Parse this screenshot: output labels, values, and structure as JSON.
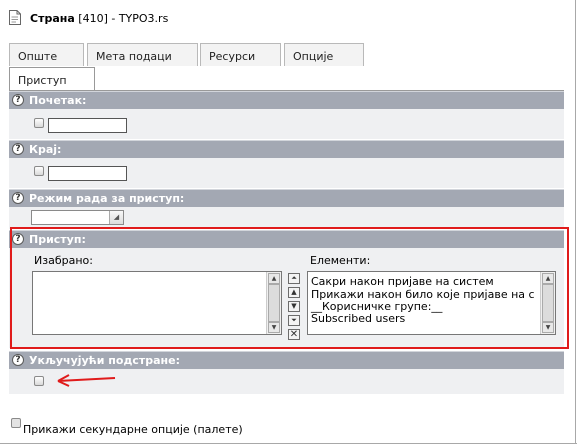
{
  "header": {
    "title_bold": "Страна",
    "title_rest": " [410] - TYPO3.rs"
  },
  "tabs": [
    {
      "label": "Опште",
      "active": false
    },
    {
      "label": "Мета подаци",
      "active": false
    },
    {
      "label": "Ресурси",
      "active": false
    },
    {
      "label": "Опције",
      "active": false
    },
    {
      "label": "Приступ",
      "active": true
    }
  ],
  "sections": {
    "start": {
      "label": "Почетак:",
      "value": ""
    },
    "end": {
      "label": "Крај:",
      "value": ""
    },
    "access_mode": {
      "label": "Режим рада за приступ:",
      "selected": ""
    },
    "access": {
      "label": "Приступ:",
      "selected_label": "Изабрано:",
      "items_label": "Елементи:",
      "selected_items": [],
      "available_items": [
        "Сакри након пријаве на систем",
        "Прикажи након било које пријаве на с",
        "__Корисничке групе:__",
        "Subscribed users"
      ]
    },
    "include_subpages": {
      "label": "Укључујући подстране:",
      "checked": false
    }
  },
  "footer": {
    "secondary_options_label": "Прикажи секундарне опције (палете)"
  },
  "colors": {
    "section_bar": "#a3a8b3",
    "section_bg": "#eff0f2",
    "highlight_red": "#e01b1b"
  },
  "icons": [
    "page-icon",
    "help-icon",
    "calendar-checkbox",
    "move-up-icon",
    "move-down-icon",
    "remove-icon",
    "red-arrow-icon"
  ]
}
